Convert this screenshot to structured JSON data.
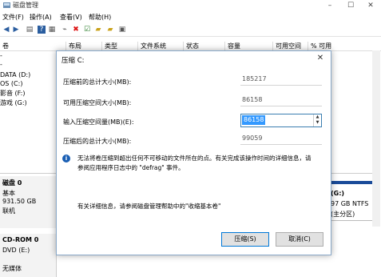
{
  "window": {
    "title": "磁盘管理",
    "minimize": "–",
    "maximize": "☐",
    "close": "✕"
  },
  "menu": [
    "文件(F)",
    "操作(A)",
    "查看(V)",
    "帮助(H)"
  ],
  "columns": [
    "卷",
    "布局",
    "类型",
    "文件系统",
    "状态",
    "容量",
    "可用空间",
    "% 可用"
  ],
  "volumes": [
    "-",
    "-",
    "DATA (D:)",
    "OS (C:)",
    "影音 (F:)",
    "游戏 (G:)"
  ],
  "disk0": {
    "name": "磁盘 0",
    "type": "基本",
    "size": "931.50 GB",
    "status": "联机"
  },
  "cdrom": {
    "name": "CD-ROM 0",
    "drive": "DVD (E:)",
    "media": "无媒体"
  },
  "right_partition": {
    "name": "(G:)",
    "size": "97 GB NTFS",
    "status": "(主分区)"
  },
  "dialog": {
    "title": "压缩 C:",
    "close": "✕",
    "rows": [
      {
        "label": "压缩前的总计大小(MB):",
        "value": "185217"
      },
      {
        "label": "可用压缩空间大小(MB):",
        "value": "86158"
      },
      {
        "label": "输入压缩空间量(MB)(E):",
        "value": "86158"
      },
      {
        "label": "压缩后的总计大小(MB):",
        "value": "99059"
      }
    ],
    "info_line1": "无法将卷压缩到超出任何不可移动的文件所在的点。有关完成该操作时间的详细信息，请",
    "info_line2": "参阅应用程序日志中的 \"defrag\" 事件。",
    "more_info": "有关详细信息，请参阅磁盘管理帮助中的\"收缩基本卷\"",
    "ok_button": "压缩(S)",
    "cancel_button": "取消(C)"
  }
}
